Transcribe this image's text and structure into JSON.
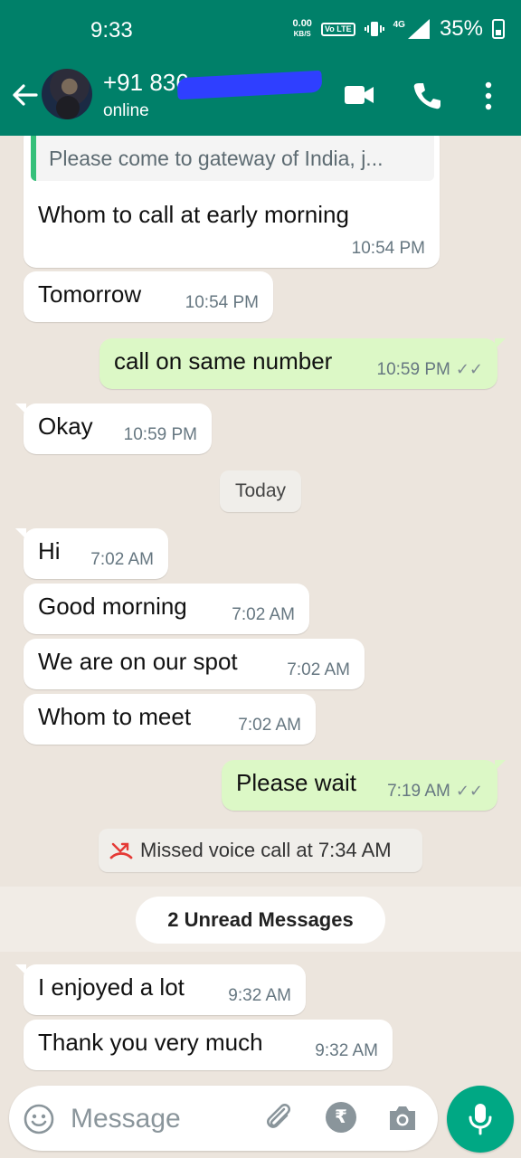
{
  "status_bar": {
    "time": "9:33",
    "speed_value": "0.00",
    "speed_unit": "KB/S",
    "volte": "Vo LTE",
    "network": "4G",
    "battery": "35%"
  },
  "header": {
    "contact_name": "+91 836",
    "contact_status": "online"
  },
  "chat": {
    "quoted_text": "Please come to gateway of India,  j...",
    "messages": [
      {
        "text": "Whom to call at early morning",
        "time": "10:54 PM",
        "dir": "in"
      },
      {
        "text": "Tomorrow",
        "time": "10:54 PM",
        "dir": "in"
      },
      {
        "text": "call on same number",
        "time": "10:59 PM",
        "dir": "out"
      },
      {
        "text": "Okay",
        "time": "10:59 PM",
        "dir": "in"
      },
      {
        "text": "Hi",
        "time": "7:02 AM",
        "dir": "in"
      },
      {
        "text": "Good morning",
        "time": "7:02 AM",
        "dir": "in"
      },
      {
        "text": "We are on our spot",
        "time": "7:02 AM",
        "dir": "in"
      },
      {
        "text": "Whom to meet",
        "time": "7:02 AM",
        "dir": "in"
      },
      {
        "text": "Please wait",
        "time": "7:19 AM",
        "dir": "out"
      },
      {
        "text": "I enjoyed a lot",
        "time": "9:32 AM",
        "dir": "in"
      },
      {
        "text": "Thank you very much",
        "time": "9:32 AM",
        "dir": "in"
      }
    ],
    "date_divider": "Today",
    "missed_call": "Missed voice call at 7:34 AM",
    "unread_label": "2 Unread Messages"
  },
  "input": {
    "placeholder": "Message",
    "rupee_symbol": "₹"
  },
  "colors": {
    "header": "#008069",
    "outgoing": "#dcf8c6",
    "incoming": "#ffffff",
    "accent": "#00a884"
  },
  "icons": [
    "back-arrow-icon",
    "video-call-icon",
    "phone-icon",
    "more-vert-icon",
    "missed-call-icon",
    "emoji-icon",
    "attach-icon",
    "rupee-icon",
    "camera-icon",
    "mic-icon",
    "double-tick-icon"
  ]
}
